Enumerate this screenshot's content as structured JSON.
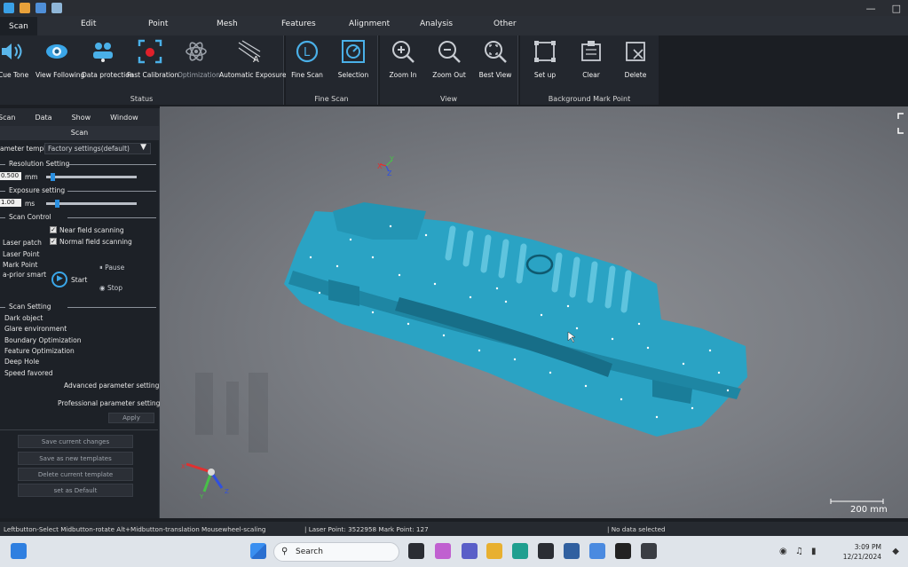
{
  "ribbon_tabs": [
    "Scan",
    "Edit",
    "Point",
    "Mesh",
    "Features",
    "Alignment",
    "Analysis",
    "Other"
  ],
  "status_group": {
    "label": "Status",
    "buttons": [
      "Cue Tone",
      "View Following",
      "Data protection",
      "Fast Calibration",
      "Optimization",
      "Automatic Exposure"
    ]
  },
  "fine_scan_group": {
    "label": "Fine Scan",
    "buttons": [
      "Fine Scan",
      "Selection"
    ]
  },
  "view_group": {
    "label": "View",
    "buttons": [
      "Zoom In",
      "Zoom Out",
      "Best View"
    ]
  },
  "bg_mark_group": {
    "label": "Background Mark Point",
    "buttons": [
      "Set up",
      "Clear",
      "Delete"
    ]
  },
  "left_panel": {
    "tabs": [
      "Scan",
      "Data",
      "Show",
      "Window"
    ],
    "header": "Scan",
    "param_template_label": "ameter template",
    "param_template_value": "Factory settings(default)",
    "resolution_section": "Resolution Setting",
    "resolution_value": "0.500",
    "resolution_unit": "mm",
    "resolution_level": 0.05,
    "exposure_section": "Exposure setting",
    "exposure_value": "1.00",
    "exposure_unit": "ms",
    "exposure_level": 0.1,
    "scan_control_section": "Scan Control",
    "near_field": "Near field scanning",
    "normal_field": "Normal field scanning",
    "modes": [
      "Laser patch",
      "Laser Point",
      "Mark Point",
      "a-prior smart"
    ],
    "start": "Start",
    "pause": "Pause",
    "stop": "Stop",
    "scan_setting_section": "Scan Setting",
    "scan_settings": [
      "Dark object",
      "Glare environment",
      "Boundary Optimization",
      "Feature Optimization",
      "Deep Hole",
      "Speed favored"
    ],
    "advanced": "Advanced parameter setting",
    "professional": "Professional parameter setting",
    "apply": "Apply",
    "buttons": [
      "Save current changes",
      "Save as new templates",
      "Delete current template",
      "set as Default"
    ]
  },
  "viewport": {
    "scale_label": "200 mm",
    "axis_x": "X",
    "axis_y": "Y",
    "axis_z": "Z"
  },
  "statusbar": {
    "hint": "Leftbutton-Select Midbutton-rotate Alt+Midbutton-translation Mousewheel-scaling",
    "points": "| Laser Point: 3522958 Mark Point: 127",
    "selection": "| No data selected"
  },
  "taskbar": {
    "search_placeholder": "Search",
    "time": "3:09 PM",
    "date": "12/21/2024"
  },
  "colors": {
    "scan_blue": "#2aa3c4",
    "accent_blue": "#2a8fe0",
    "record_red": "#e0202a"
  }
}
